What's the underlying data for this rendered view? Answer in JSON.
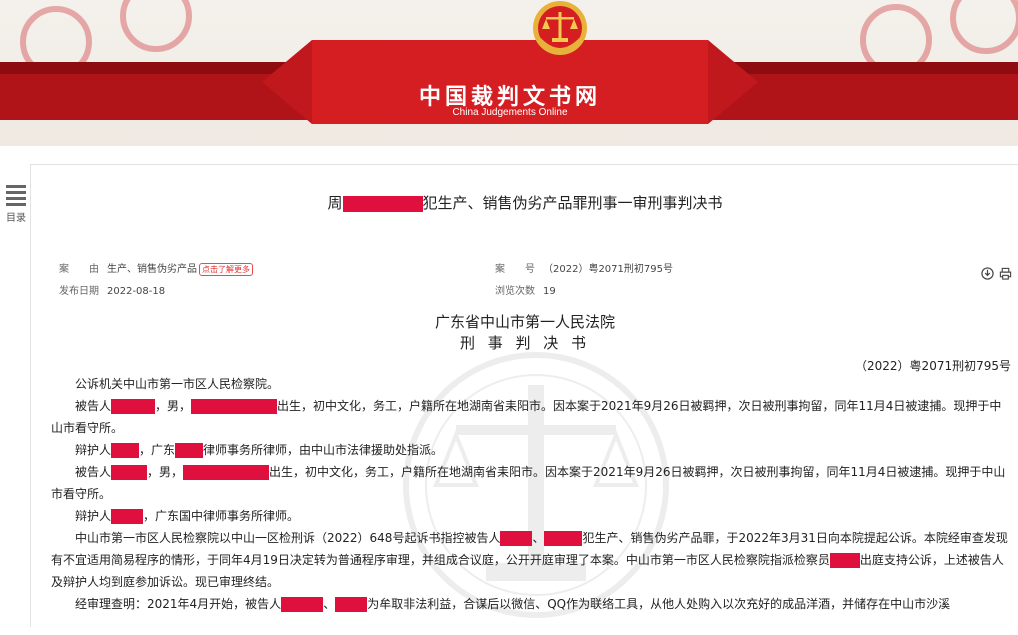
{
  "header": {
    "site_title": "中国裁判文书网",
    "site_subtitle": "China Judgements Online",
    "colors": {
      "brand_red": "#b01418",
      "ribbon_red": "#d41e22",
      "gold": "#e8b23a",
      "redaction": "#e0103e"
    }
  },
  "catalog": {
    "label": "目录",
    "icon": "list-icon"
  },
  "document": {
    "title_prefix": "周",
    "title_suffix": "犯生产、销售伪劣产品罪刑事一审刑事判决书",
    "meta": {
      "cause_label": "案　　由",
      "cause_value": "生产、销售伪劣产品",
      "more_label": "点击了解更多",
      "case_no_label": "案　　号",
      "case_no_value": "（2022）粤2071刑初795号",
      "publish_label": "发布日期",
      "publish_value": "2022-08-18",
      "views_label": "浏览次数",
      "views_value": "19"
    },
    "tools": {
      "download_icon": "download-icon",
      "print_icon": "print-icon"
    },
    "court_name": "广东省中山市第一人民法院",
    "doc_type": "刑 事 判 决 书",
    "case_number": "（2022）粤2071刑初795号",
    "paragraphs": {
      "p1": "公诉机关中山市第一市区人民检察院。",
      "p2a": "被告人",
      "p2b": "，男，",
      "p2c": "出生，初中文化，务工，户籍所在地湖南省耒阳市。因本案于2021年9月26日被羁押，次日被刑事拘留，同年11月4日被逮捕。现押于中山市看守所。",
      "p3a": "辩护人",
      "p3b": "，广东",
      "p3c": "律师事务所律师，由中山市法律援助处指派。",
      "p4a": "被告人",
      "p4b": "，男，",
      "p4c": "出生，初中文化，务工，户籍所在地湖南省耒阳市。因本案于2021年9月26日被羁押，次日被刑事拘留，同年11月4日被逮捕。现押于中山市看守所。",
      "p5a": "辩护人",
      "p5b": "，广东国中律师事务所律师。",
      "p6a": "中山市第一市区人民检察院以中山一区检刑诉（2022）648号起诉书指控被告人",
      "p6b": "、",
      "p6c": "犯生产、销售伪劣产品罪，于2022年3月31日向本院提起公诉。本院经审查发现有不宜适用简易程序的情形，于同年4月19日决定转为普通程序审理，并组成合议庭，公开开庭审理了本案。中山市第一市区人民检察院指派检察员",
      "p6d": "出庭支持公诉，上述被告人及辩护人均到庭参加诉讼。现已审理终结。",
      "p7a": "经审理查明：2021年4月开始，被告人",
      "p7b": "、",
      "p7c": "为牟取非法利益，合谋后以微信、QQ作为联络工具，从他人处购入以次充好的成品洋酒，并储存在中山市沙溪"
    }
  }
}
